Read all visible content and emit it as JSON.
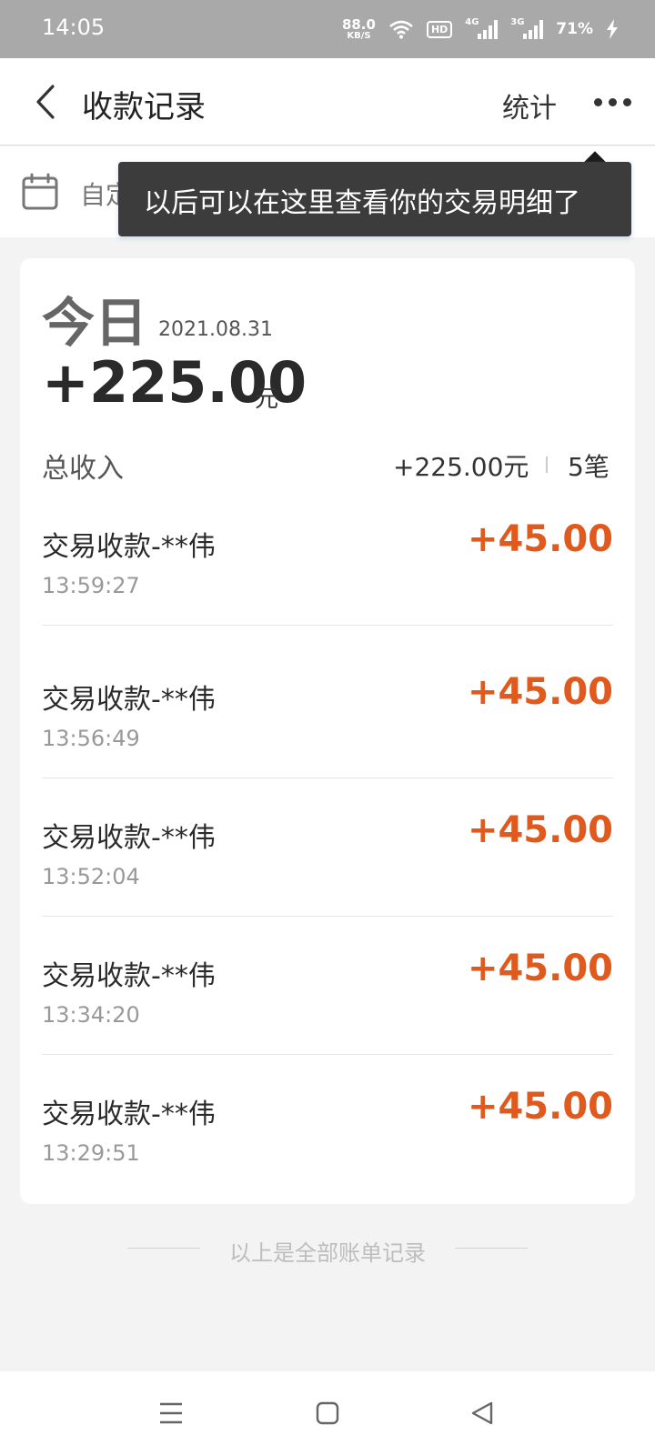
{
  "status_bar": {
    "time": "14:05",
    "net_speed_value": "88.0",
    "net_speed_unit": "KB/S",
    "hd_label": "HD",
    "sim1_label": "4G",
    "sim2_label": "3G",
    "battery": "71%"
  },
  "header": {
    "title": "收款记录",
    "stats_label": "统计"
  },
  "filter": {
    "label": "自定义查询"
  },
  "tooltip": {
    "text": "以后可以在这里查看你的交易明细了"
  },
  "summary": {
    "day_label": "今日",
    "date": "2021.08.31",
    "total": "+225.00",
    "unit": "元",
    "income_label": "总收入",
    "income_sum": "+225.00元",
    "count": "5笔"
  },
  "transactions": [
    {
      "name": "交易收款-**伟",
      "time": "13:59:27",
      "amount": "+45.00"
    },
    {
      "name": "交易收款-**伟",
      "time": "13:56:49",
      "amount": "+45.00"
    },
    {
      "name": "交易收款-**伟",
      "time": "13:52:04",
      "amount": "+45.00"
    },
    {
      "name": "交易收款-**伟",
      "time": "13:34:20",
      "amount": "+45.00"
    },
    {
      "name": "交易收款-**伟",
      "time": "13:29:51",
      "amount": "+45.00"
    }
  ],
  "end_note": "以上是全部账单记录",
  "colors": {
    "accent_amount": "#e05a1e",
    "status_bar_bg": "#a9a9a9",
    "tooltip_bg": "#3c3c3c"
  },
  "icons": {
    "back": "chevron-left-icon",
    "more": "more-horizontal-icon",
    "calendar": "calendar-icon",
    "wifi": "wifi-icon",
    "battery": "charging-icon",
    "nav_menu": "menu-icon",
    "nav_home": "home-square-icon",
    "nav_back": "triangle-back-icon"
  }
}
